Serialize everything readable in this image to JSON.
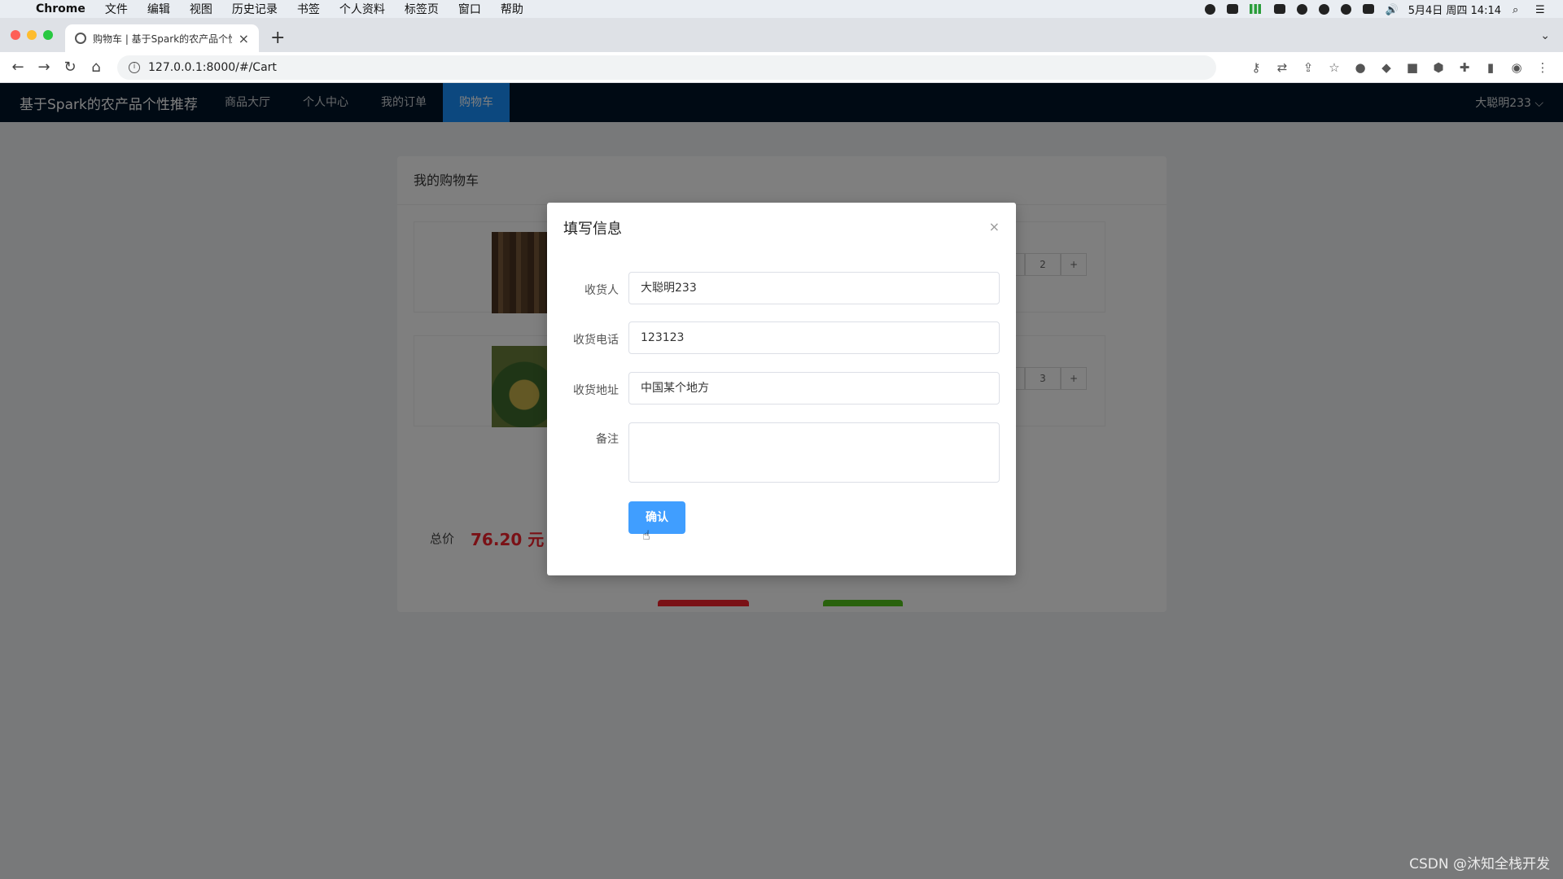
{
  "mac_menu": {
    "apple": "",
    "app": "Chrome",
    "items": [
      "文件",
      "编辑",
      "视图",
      "历史记录",
      "书签",
      "个人资料",
      "标签页",
      "窗口",
      "帮助"
    ],
    "datetime": "5月4日 周四 14:14"
  },
  "browser": {
    "tab_title": "购物车 | 基于Spark的农产品个性",
    "url": "127.0.0.1:8000/#/Cart"
  },
  "site": {
    "brand": "基于Spark的农产品个性推荐",
    "menu": [
      "商品大厅",
      "个人中心",
      "我的订单",
      "购物车"
    ],
    "active_menu": "购物车",
    "user": "大聪明233 ⌵"
  },
  "cart": {
    "title": "我的购物车",
    "items": [
      {
        "quantity": "2"
      },
      {
        "quantity": "3"
      }
    ],
    "total_label": "总价",
    "total_value": "76.20 元"
  },
  "modal": {
    "title": "填写信息",
    "fields": {
      "receiver_label": "收货人",
      "receiver_value": "大聪明233",
      "phone_label": "收货电话",
      "phone_value": "123123",
      "address_label": "收货地址",
      "address_value": "中国某个地方",
      "note_label": "备注",
      "note_value": ""
    },
    "confirm_label": "确认"
  },
  "footer_credit": "CSDN @沐知全栈开发",
  "colors": {
    "nav_bg": "#001529",
    "accent": "#1890ff",
    "confirm": "#409eff",
    "price": "#f5222d"
  }
}
